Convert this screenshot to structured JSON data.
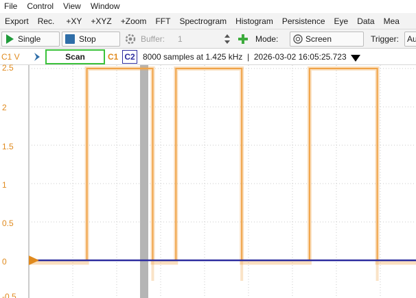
{
  "menu": [
    "File",
    "Control",
    "View",
    "Window"
  ],
  "toolbar": [
    "Export",
    "Rec.",
    "+XY",
    "+XYZ",
    "+Zoom",
    "FFT",
    "Spectrogram",
    "Histogram",
    "Persistence",
    "Eye",
    "Data",
    "Mea"
  ],
  "controls": {
    "single_label": "Single",
    "stop_label": "Stop",
    "buffer_label": "Buffer:",
    "buffer_value": "1",
    "mode_label": "Mode:",
    "mode_value": "Screen",
    "trigger_label": "Trigger:",
    "trigger_value": "Au"
  },
  "status": {
    "channel_unit": "C1 V",
    "scan_label": "Scan",
    "c1": "C1",
    "c2": "C2",
    "info": "8000 samples at 1.425 kHz  |  2026-03-02 16:05:25.723"
  },
  "colors": {
    "c1": "#f0a347",
    "c2": "#2d2d9f",
    "scan_border": "#3ac23a"
  },
  "chart_data": {
    "type": "line",
    "ylabel": "C1 V",
    "yticks": [
      "2.5",
      "2",
      "1.5",
      "1",
      "0.5",
      "0",
      "-0.5"
    ],
    "ylim": [
      -0.5,
      2.5
    ],
    "grid": true,
    "series": [
      {
        "name": "C1",
        "points": [
          [
            0,
            0
          ],
          [
            0.15,
            0
          ],
          [
            0.15,
            2.5
          ],
          [
            0.32,
            2.5
          ],
          [
            0.32,
            0
          ],
          [
            0.38,
            0
          ],
          [
            0.38,
            2.5
          ],
          [
            0.55,
            2.5
          ],
          [
            0.55,
            0
          ],
          [
            0.725,
            0
          ],
          [
            0.725,
            2.5
          ],
          [
            0.9,
            2.5
          ],
          [
            0.9,
            0
          ],
          [
            1,
            0
          ]
        ]
      },
      {
        "name": "C2",
        "points": [
          [
            0,
            0
          ],
          [
            1,
            0
          ]
        ]
      }
    ]
  }
}
